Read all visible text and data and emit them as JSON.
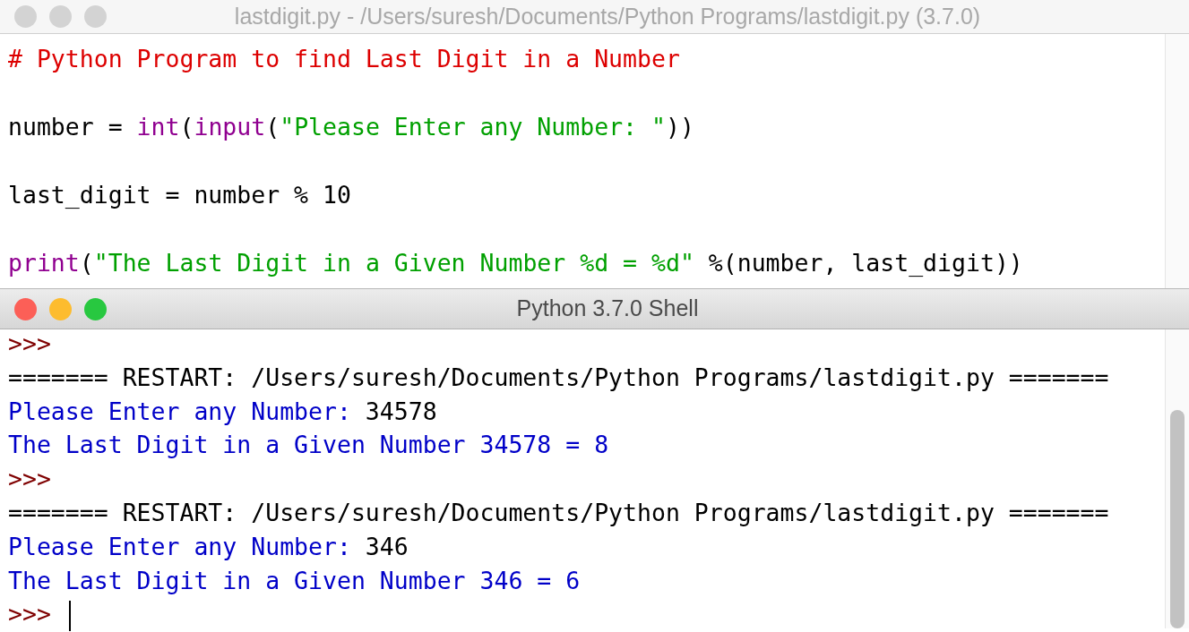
{
  "editor": {
    "title": "lastdigit.py - /Users/suresh/Documents/Python Programs/lastdigit.py (3.7.0)",
    "active": false,
    "lines": [
      [
        {
          "kind": "comment",
          "text": "# Python Program to find Last Digit in a Number"
        }
      ],
      [
        {
          "kind": "plain",
          "text": "number = "
        },
        {
          "kind": "builtin",
          "text": "int"
        },
        {
          "kind": "plain",
          "text": "("
        },
        {
          "kind": "builtin",
          "text": "input"
        },
        {
          "kind": "plain",
          "text": "("
        },
        {
          "kind": "string",
          "text": "\"Please Enter any Number: \""
        },
        {
          "kind": "plain",
          "text": "))"
        }
      ],
      [
        {
          "kind": "plain",
          "text": "last_digit = number % 10"
        }
      ],
      [
        {
          "kind": "builtin",
          "text": "print"
        },
        {
          "kind": "plain",
          "text": "("
        },
        {
          "kind": "string",
          "text": "\"The Last Digit in a Given Number %d = %d\""
        },
        {
          "kind": "plain",
          "text": " %(number, last_digit))"
        }
      ]
    ]
  },
  "shell": {
    "title": "Python 3.7.0 Shell",
    "active": true,
    "cursor": true,
    "lines": [
      [
        {
          "kind": "prompt",
          "text": ">>>"
        }
      ],
      [
        {
          "kind": "plain",
          "text": "======= RESTART: /Users/suresh/Documents/Python Programs/lastdigit.py ======="
        }
      ],
      [
        {
          "kind": "output",
          "text": "Please Enter any Number: "
        },
        {
          "kind": "plain",
          "text": "34578"
        }
      ],
      [
        {
          "kind": "output",
          "text": "The Last Digit in a Given Number 34578 = 8"
        }
      ],
      [
        {
          "kind": "prompt",
          "text": ">>>"
        }
      ],
      [
        {
          "kind": "plain",
          "text": "======= RESTART: /Users/suresh/Documents/Python Programs/lastdigit.py ======="
        }
      ],
      [
        {
          "kind": "output",
          "text": "Please Enter any Number: "
        },
        {
          "kind": "plain",
          "text": "346"
        }
      ],
      [
        {
          "kind": "output",
          "text": "The Last Digit in a Given Number 346 = 6"
        }
      ],
      [
        {
          "kind": "prompt",
          "text": ">>> "
        }
      ]
    ]
  }
}
